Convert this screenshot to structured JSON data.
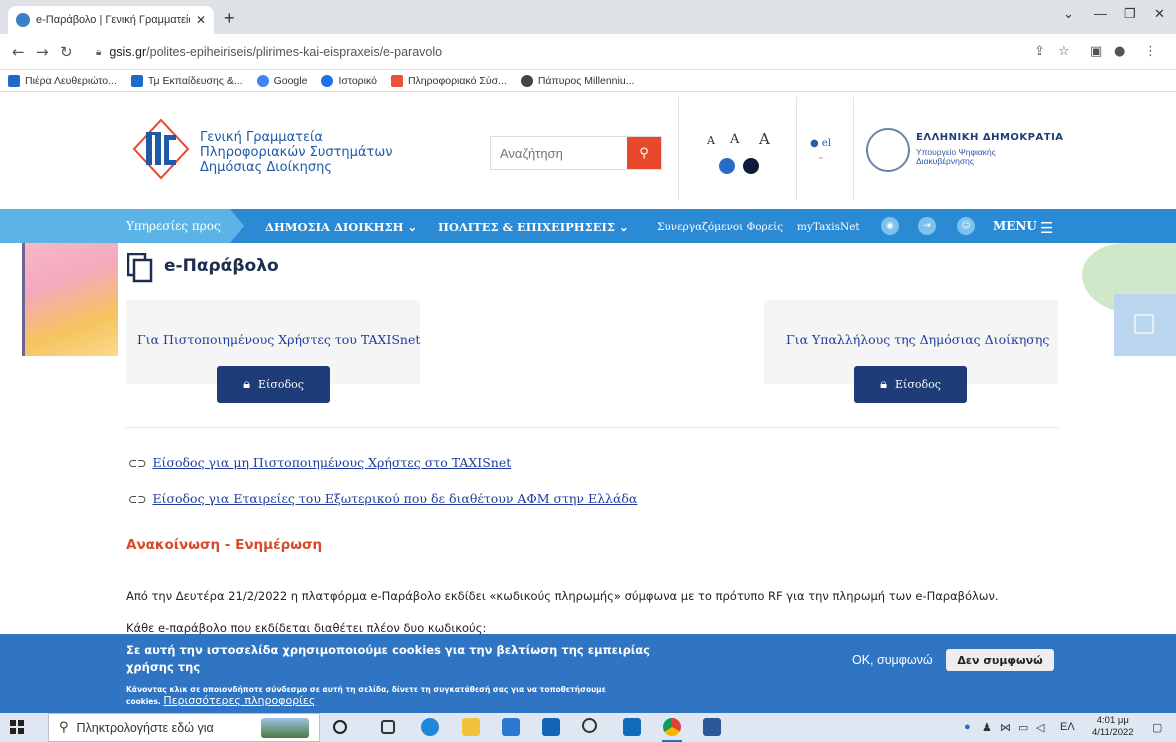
{
  "browser": {
    "tab_title": "e-Παράβολο | Γενική Γραμματεία Πληροφοριακών Συστημάτων",
    "tab_close": "✕",
    "new_tab": "+",
    "url_host": "gsis.gr",
    "url_path": "/polites-epiheiriseis/plirimes-kai-eispraxeis/e-paravolo",
    "bookmarks": [
      {
        "label": "Πιέρα Λευθεριώτο...",
        "icon": "outlook-icon",
        "color": "#1f6cc8"
      },
      {
        "label": "Τμ Εκπαίδευσης &...",
        "icon": "outlook-icon",
        "color": "#1f6cc8"
      },
      {
        "label": "Google",
        "icon": "google-icon",
        "color": "#4285f4"
      },
      {
        "label": "Ιστορικό",
        "icon": "history-icon",
        "color": "#1a73e8"
      },
      {
        "label": "Πληροφοριακό Σύσ...",
        "icon": "folder-icon",
        "color": "#e8533a"
      },
      {
        "label": "Πάπυρος Millenniu...",
        "icon": "globe-icon",
        "color": "#444444"
      }
    ]
  },
  "header": {
    "logo_lines": [
      "Γενική Γραμματεία",
      "Πληροφοριακών Συστημάτων",
      "Δημόσιας Διοίκησης"
    ],
    "search_placeholder": "Αναζήτηση",
    "font_sizes": [
      "A",
      "A",
      "A"
    ],
    "lang": "el",
    "gov_title": "ΕΛΛΗΝΙΚΗ ΔΗΜΟΚΡΑΤΙΑ",
    "gov_sub_1": "Υπουργείο Ψηφιακής",
    "gov_sub_2": "Διακυβέρνησης"
  },
  "nav": {
    "services_label": "Υπηρεσίες προς",
    "item_public": "ΔΗΜΟΣΙΑ ΔΙΟΙΚΗΣΗ",
    "item_citizens": "ΠΟΛΙΤΕΣ & ΕΠΙΧΕΙΡΗΣΕΙΣ",
    "item_partners": "Συνεργαζόμενοι Φορείς",
    "item_taxisnet": "myTaxisNet",
    "menu_label": "MENU"
  },
  "content": {
    "page_title": "e-Παράβολο",
    "card_left_label": "Για Πιστοποιημένους Χρήστες του TAXISnet",
    "card_right_label": "Για Υπαλλήλους της Δημόσιας Διοίκησης",
    "login_label": "Είσοδος",
    "link_1": "Είσοδος για μη Πιστοποιημένους Χρήστες στο TAXISnet",
    "link_2": "Είσοδος για Εταιρείες του Εξωτερικού που δε διαθέτουν ΑΦΜ στην Ελλάδα",
    "announce_heading": "Ανακοίνωση - Ενημέρωση",
    "para_1": "Από την Δευτέρα 21/2/2022 η πλατφόρμα e-Παράβολο εκδίδει «κωδικούς πληρωμής» σύμφωνα με το πρότυπο RF για την πληρωμή των e-Παραβόλων.",
    "para_2": "Κάθε e-παράβολο που εκδίδεται διαθέτει πλέον δυο κωδικούς:"
  },
  "cookie": {
    "heading": "Σε αυτή την ιστοσελίδα χρησιμοποιούμε cookies για την βελτίωση της εμπειρίας χρήσης της",
    "small_text": "Κάνοντας κλικ σε οποιονδήποτε σύνδεσμο σε αυτή τη σελίδα, δίνετε τη συγκατάθεσή σας για να τοποθετήσουμε",
    "small_text_2": "cookies.",
    "more_link": "Περισσότερες πληροφορίες",
    "ok_label": "OK, συμφωνώ",
    "decline_label": "Δεν συμφωνώ"
  },
  "taskbar": {
    "search_placeholder": "Πληκτρολογήστε εδώ για",
    "lang": "ΕΛ",
    "time": "4:01 μμ",
    "date": "4/11/2022"
  },
  "colors": {
    "nav_blue": "#2a8bd4",
    "accent_red": "#e8482c",
    "button_navy": "#1e3c78",
    "cookie_blue": "#2f75c4"
  }
}
